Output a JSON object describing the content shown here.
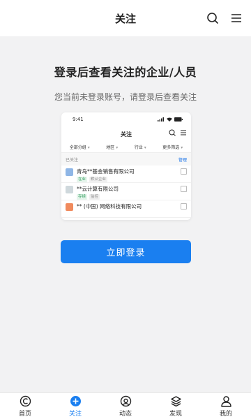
{
  "header": {
    "title": "关注"
  },
  "main": {
    "headline": "登录后查看关注的企业/人员",
    "subline": "您当前未登录账号，请登录后查看关注",
    "login_button": "立即登录"
  },
  "preview": {
    "status_time": "9:41",
    "nav_title": "关注",
    "filters": [
      "全部分组",
      "地区",
      "行业",
      "更多筛选"
    ],
    "followed_label": "已关注",
    "manage": "管理",
    "rows": [
      {
        "name": "青岛**基金销售有限公司",
        "tags": [
          "在业",
          "默认企业"
        ],
        "logo_color": "#8fb6e6"
      },
      {
        "name": "**云计算有限公司",
        "tags": [
          "存续",
          "监控"
        ],
        "logo_color": "#cfd8dc"
      },
      {
        "name": "** (中国) 网络科技有限公司",
        "tags": [],
        "logo_color": "#f08a5d"
      }
    ]
  },
  "tabbar": {
    "items": [
      {
        "label": "首页",
        "icon": "home-icon"
      },
      {
        "label": "关注",
        "icon": "plus-circle-icon",
        "active": true
      },
      {
        "label": "动态",
        "icon": "activity-icon"
      },
      {
        "label": "发现",
        "icon": "layers-icon"
      },
      {
        "label": "我的",
        "icon": "user-icon"
      }
    ]
  },
  "colors": {
    "accent": "#1a7ff0",
    "background": "#f2f2f3"
  }
}
